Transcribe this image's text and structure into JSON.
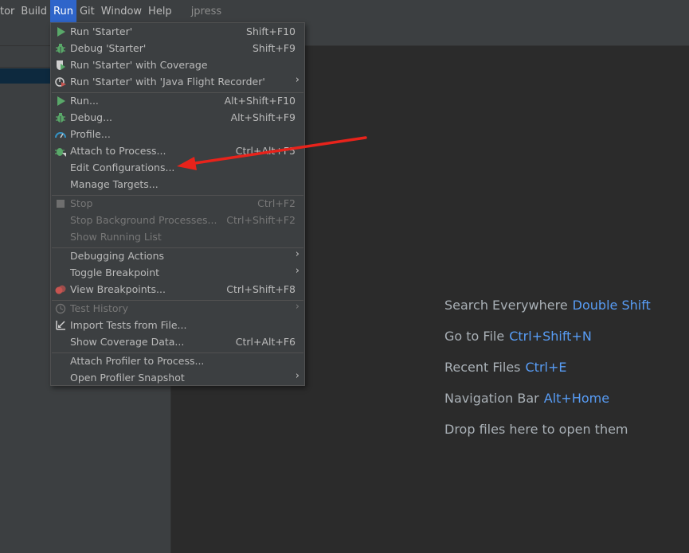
{
  "menubar": {
    "items": [
      "tor",
      "Build",
      "Run",
      "Git",
      "Window",
      "Help"
    ],
    "project": "jpress"
  },
  "run_menu": {
    "items": [
      {
        "label": "Run 'Starter'",
        "shortcut": "Shift+F10",
        "icon": "run-triangle-icon"
      },
      {
        "label": "Debug 'Starter'",
        "shortcut": "Shift+F9",
        "icon": "bug-icon"
      },
      {
        "label": "Run 'Starter' with Coverage",
        "shortcut": "",
        "icon": "coverage-shield-icon"
      },
      {
        "label": "Run 'Starter' with 'Java Flight Recorder'",
        "shortcut": "",
        "icon": "flight-recorder-icon",
        "submenu": true
      },
      {
        "label": "Run...",
        "shortcut": "Alt+Shift+F10",
        "icon": "run-triangle-icon"
      },
      {
        "label": "Debug...",
        "shortcut": "Alt+Shift+F9",
        "icon": "bug-icon"
      },
      {
        "label": "Profile...",
        "shortcut": "",
        "icon": "profile-gauge-icon"
      },
      {
        "label": "Attach to Process...",
        "shortcut": "Ctrl+Alt+F5",
        "icon": "attach-bug-icon"
      },
      {
        "label": "Edit Configurations...",
        "shortcut": ""
      },
      {
        "label": "Manage Targets...",
        "shortcut": ""
      },
      {
        "label": "Stop",
        "shortcut": "Ctrl+F2",
        "icon": "stop-square-icon",
        "disabled": true
      },
      {
        "label": "Stop Background Processes...",
        "shortcut": "Ctrl+Shift+F2",
        "disabled": true
      },
      {
        "label": "Show Running List",
        "shortcut": "",
        "disabled": true
      },
      {
        "label": "Debugging Actions",
        "shortcut": "",
        "submenu": true
      },
      {
        "label": "Toggle Breakpoint",
        "shortcut": "",
        "submenu": true
      },
      {
        "label": "View Breakpoints...",
        "shortcut": "Ctrl+Shift+F8",
        "icon": "breakpoints-icon"
      },
      {
        "label": "Test History",
        "shortcut": "",
        "icon": "clock-icon",
        "disabled": true,
        "submenu": true
      },
      {
        "label": "Import Tests from File...",
        "shortcut": "",
        "icon": "import-arrow-icon"
      },
      {
        "label": "Show Coverage Data...",
        "shortcut": "Ctrl+Alt+F6"
      },
      {
        "label": "Attach Profiler to Process...",
        "shortcut": ""
      },
      {
        "label": "Open Profiler Snapshot",
        "shortcut": "",
        "submenu": true
      }
    ]
  },
  "editor_hints": [
    {
      "text": "Search Everywhere",
      "key": "Double Shift"
    },
    {
      "text": "Go to File",
      "key": "Ctrl+Shift+N"
    },
    {
      "text": "Recent Files",
      "key": "Ctrl+E"
    },
    {
      "text": "Navigation Bar",
      "key": "Alt+Home"
    },
    {
      "text": "Drop files here to open them",
      "key": ""
    }
  ],
  "colors": {
    "accent": "#2f65ca",
    "shortcut_key": "#589df6",
    "annotation_arrow": "#e8231b",
    "run_green": "#59a869",
    "breakpoint_red": "#c75450"
  }
}
